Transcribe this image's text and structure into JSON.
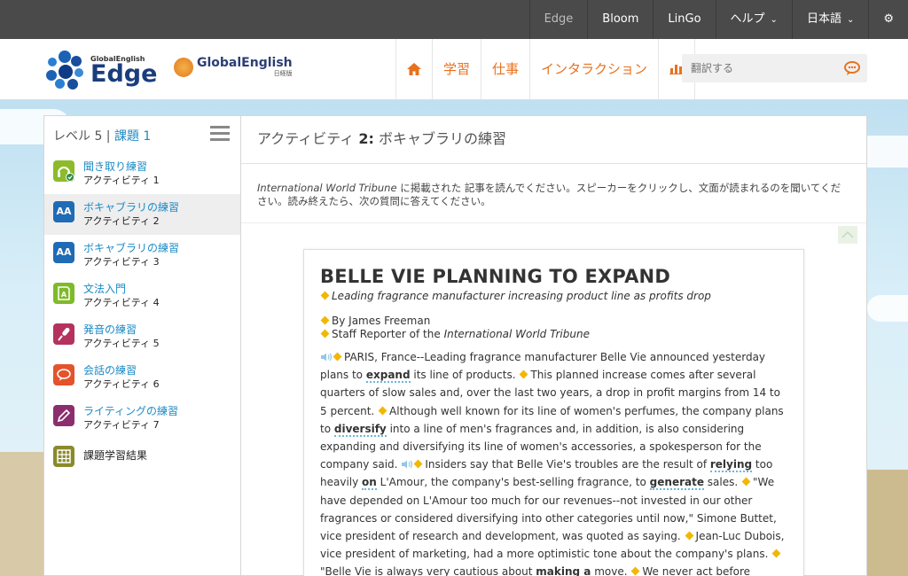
{
  "topnav": {
    "items": [
      "Edge",
      "Bloom",
      "LinGo",
      "ヘルプ",
      "日本語"
    ]
  },
  "logos": {
    "edge_small": "GlobalEnglish",
    "edge_big": "Edge",
    "ge_text": "GlobalEnglish",
    "ge_sub": "日経版"
  },
  "mainnav": {
    "items": [
      "学習",
      "仕事",
      "インタラクション"
    ]
  },
  "search": {
    "placeholder": "翻訳する"
  },
  "sidebar": {
    "level_label": "レベル 5 | ",
    "task_label": "課題 1",
    "items": [
      {
        "title": "聞き取り練習",
        "sub": "アクティビティ 1",
        "color": "#8dbb2b"
      },
      {
        "title": "ボキャブラリの練習",
        "sub": "アクティビティ 2",
        "color": "#1f6bb5"
      },
      {
        "title": "ボキャブラリの練習",
        "sub": "アクティビティ 3",
        "color": "#1f6bb5"
      },
      {
        "title": "文法入門",
        "sub": "アクティビティ 4",
        "color": "#7fba2a"
      },
      {
        "title": "発音の練習",
        "sub": "アクティビティ 5",
        "color": "#b5325e"
      },
      {
        "title": "会話の練習",
        "sub": "アクティビティ 6",
        "color": "#e4532b"
      },
      {
        "title": "ライティングの練習",
        "sub": "アクティビティ 7",
        "color": "#8b2e6e"
      },
      {
        "title": "課題学習結果",
        "sub": "",
        "color": "#8b8a2b"
      }
    ]
  },
  "content": {
    "activity_prefix": "アクティビティ ",
    "activity_num": "2:",
    "activity_name": " ボキャブラリの練習",
    "instr_italic": "International World Tribune",
    "instr_text": " に掲載された 記事を読んでください。スピーカーをクリックし、文面が読まれるのを聞いてください。読み終えたら、次の質問に答えてください。"
  },
  "article": {
    "headline": "BELLE VIE PLANNING TO EXPAND",
    "subhead": "Leading fragrance manufacturer increasing product line as profits drop",
    "byline1": "By James Freeman",
    "byline2_prefix": "Staff Reporter of the ",
    "byline2_italic": "International World Tribune",
    "p1a": "PARIS, France--Leading fragrance manufacturer Belle Vie announced yesterday plans to ",
    "kw_expand": "expand",
    "p1b": " its line of products. ",
    "p2": "This planned increase comes after several quarters of slow sales and, over the last two years, a drop in profit margins from 14 to 5 percent. ",
    "p3a": "Although well known for its line of women's perfumes, the company plans to ",
    "kw_diversify": "diversify",
    "p3b": " into a line of men's fragrances and, in addition, is also considering expanding and diversifying its line of women's accessories, a spokesperson for the company said. ",
    "p4a": "Insiders say that Belle Vie's troubles are the result of ",
    "kw_relying": "relying",
    "p4b": " too heavily ",
    "kw_on": "on",
    "p4c": " L'Amour, the company's best-selling fragrance, to ",
    "kw_generate": "generate",
    "p4d": " sales. ",
    "p5": "\"We have depended on L'Amour too much for our revenues--not invested in our other fragrances or considered diversifying into other categories until now,\" Simone Buttet, vice president of research and development, was quoted as saying. ",
    "p6": "Jean-Luc Dubois, vice president of marketing, had a more optimistic tone about the company's plans. ",
    "p7a": "\"Belle Vie is always very cautious about ",
    "kw_making": "making a",
    "p7b": " move. ",
    "p8": "We never act before looking into a market; we research it very thoroughly before"
  }
}
